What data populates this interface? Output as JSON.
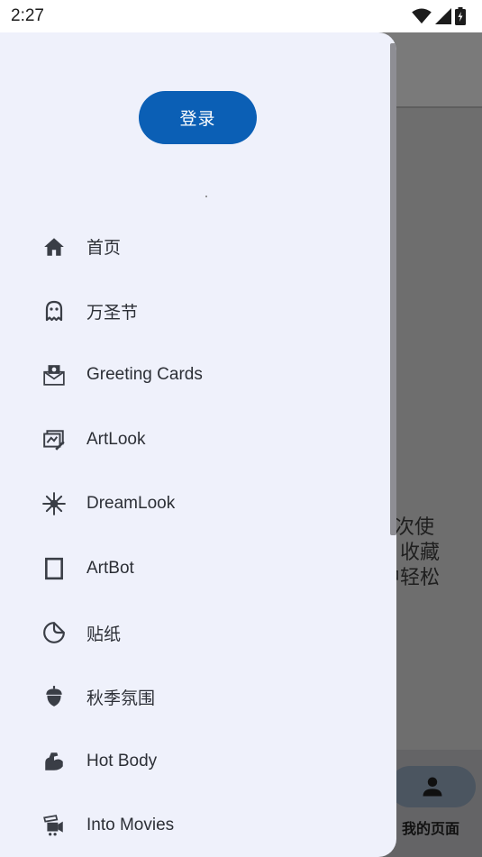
{
  "status_bar": {
    "time": "2:27"
  },
  "background": {
    "text_lines": [
      "次使",
      "收藏",
      "中轻松"
    ],
    "bottom_nav_label": "我的页面"
  },
  "drawer": {
    "login_label": "登录",
    "menu": [
      {
        "label": "首页",
        "icon": "home-icon"
      },
      {
        "label": "万圣节",
        "icon": "ghost-icon"
      },
      {
        "label": "Greeting Cards",
        "icon": "envelope-icon"
      },
      {
        "label": "ArtLook",
        "icon": "artlook-icon"
      },
      {
        "label": "DreamLook",
        "icon": "sparkle-icon"
      },
      {
        "label": "ArtBot",
        "icon": "frame-icon"
      },
      {
        "label": "贴纸",
        "icon": "sticker-icon"
      },
      {
        "label": "秋季氛围",
        "icon": "acorn-icon"
      },
      {
        "label": "Hot Body",
        "icon": "muscle-icon"
      },
      {
        "label": "Into Movies",
        "icon": "movie-icon"
      }
    ]
  },
  "colors": {
    "drawer_bg": "#eff1fb",
    "login_button": "#0b5fb5",
    "icon": "#3a3e46"
  }
}
